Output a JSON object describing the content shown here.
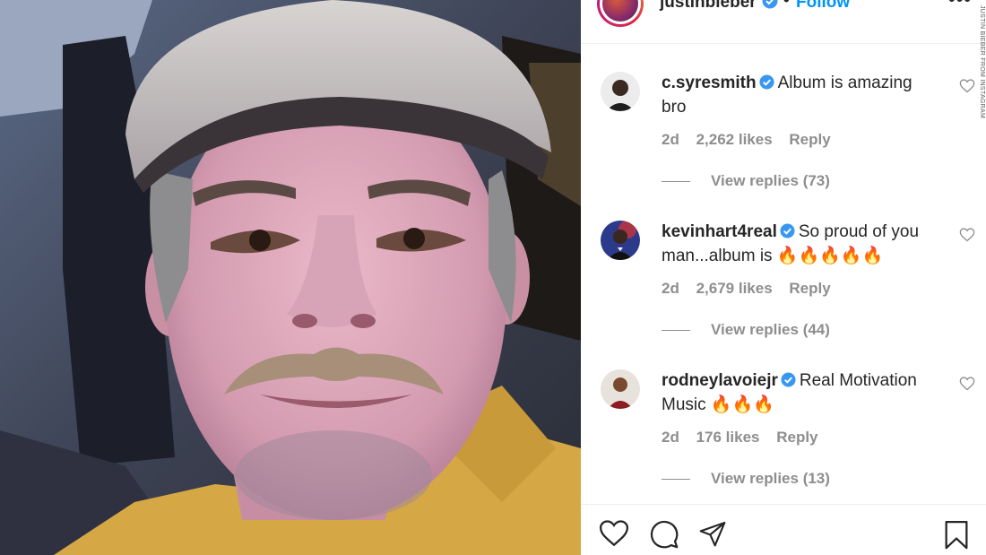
{
  "header": {
    "username": "justinbieber",
    "separator": "•",
    "follow_label": "Follow",
    "more_label": "•••"
  },
  "credit": "JUSTIN BIEBER FROM INSTAGRAM",
  "comments": [
    {
      "username": "c.syresmith",
      "text": "Album is amazing bro",
      "emoji": "",
      "age": "2d",
      "likes": "2,262 likes",
      "reply_label": "Reply",
      "view_replies": "View replies (73)"
    },
    {
      "username": "kevinhart4real",
      "text": "So proud of you man...album is",
      "emoji": "🔥🔥🔥🔥🔥",
      "age": "2d",
      "likes": "2,679 likes",
      "reply_label": "Reply",
      "view_replies": "View replies (44)"
    },
    {
      "username": "rodneylavoiejr",
      "text": "Real Motivation Music",
      "emoji": "🔥🔥🔥",
      "age": "2d",
      "likes": "176 likes",
      "reply_label": "Reply",
      "view_replies": "View replies (13)"
    }
  ],
  "actions": {
    "like": "heart-icon",
    "comment": "comment-icon",
    "share": "share-icon",
    "save": "bookmark-icon"
  },
  "colors": {
    "follow_blue": "#0095f6",
    "verified_blue": "#3897f0",
    "meta_gray": "#8e8e8e",
    "text_dark": "#262626"
  }
}
